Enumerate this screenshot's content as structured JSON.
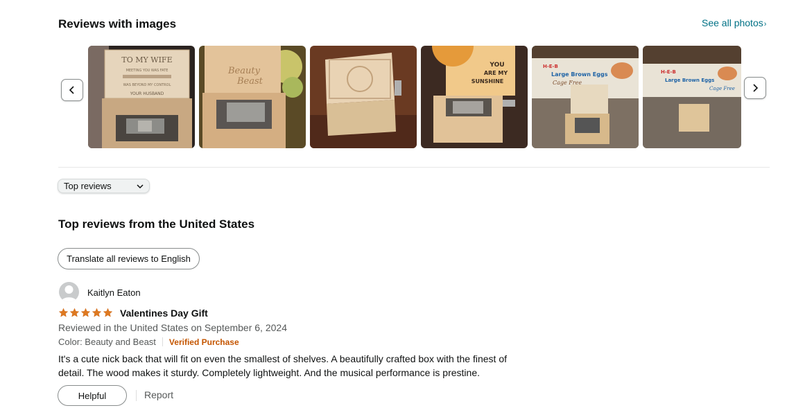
{
  "images_section": {
    "title": "Reviews with images",
    "see_all_label": "See all photos",
    "see_all_chevron": "›",
    "prev_icon": "chevron-left-icon",
    "next_icon": "chevron-right-icon",
    "photo_text": {
      "p1_lines": [
        "TO MY WIFE",
        "MEETING YOU WAS FATE",
        "WAS BEYOND MY CONTROL",
        "YOUR HUSBAND"
      ],
      "p2_lines": [
        "Beauty",
        "Beast"
      ],
      "p4_lines": [
        "YOU",
        "ARE MY",
        "SUNSHINE"
      ],
      "p5_lines": [
        "H-E-B",
        "Large Brown Eggs",
        "Cage Free"
      ],
      "p6_lines": [
        "H-E-B",
        "Large Brown Eggs",
        "Cage Free"
      ]
    }
  },
  "sort": {
    "selected": "Top reviews"
  },
  "reviews_section": {
    "title": "Top reviews from the United States",
    "translate_label": "Translate all reviews to English"
  },
  "review": {
    "author": "Kaitlyn Eaton",
    "rating": 5,
    "title": "Valentines Day Gift",
    "reviewed_in": "Reviewed in the United States on September 6, 2024",
    "variant": "Color: Beauty and Beast",
    "verified": "Verified Purchase",
    "text_line1": "It's a cute nick back that will fit on even the smallest of shelves. A beautifully crafted box with the finest of",
    "text_line2": "detail. The wood makes it sturdy. Completely lightweight. And the musical performance is prestine.",
    "helpful_label": "Helpful",
    "report_label": "Report"
  },
  "colors": {
    "link": "#007185",
    "star": "#de7921",
    "verified": "#c45500",
    "muted": "#565959"
  }
}
